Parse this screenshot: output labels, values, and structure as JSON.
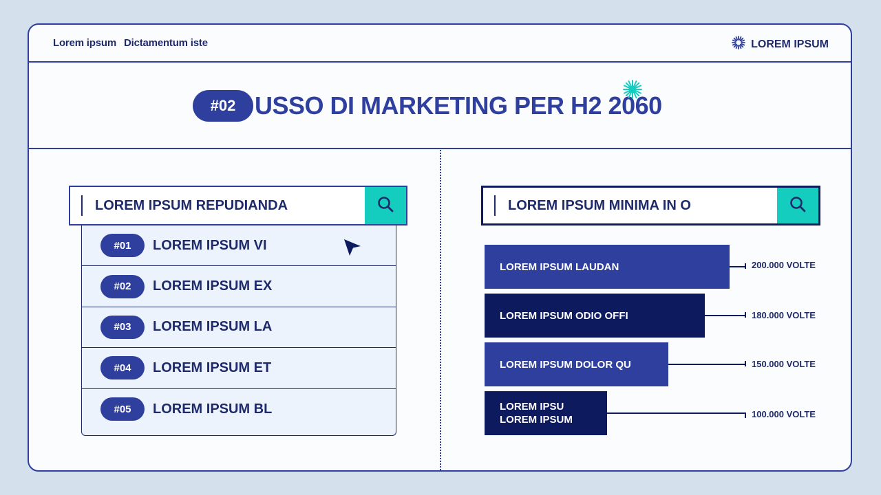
{
  "header": {
    "left_text_a": "Lorem ipsum",
    "left_text_b": "Dictamentum iste",
    "brand": "LOREM IPSUM",
    "brand_icon": "sunburst-icon"
  },
  "title": {
    "pill": "#02",
    "text": "USSO DI MARKETING PER H2 2060",
    "accent_color": "#14cdbf"
  },
  "left_search": {
    "query": "LOREM IPSUM REPUDIANDA",
    "icon": "search-icon",
    "suggestions": [
      {
        "num": "#01",
        "label": "LOREM IPSUM VI"
      },
      {
        "num": "#02",
        "label": "LOREM IPSUM EX"
      },
      {
        "num": "#03",
        "label": "LOREM IPSUM LA"
      },
      {
        "num": "#04",
        "label": "LOREM IPSUM ET"
      },
      {
        "num": "#05",
        "label": "LOREM IPSUM BL"
      }
    ]
  },
  "right_search": {
    "query": "LOREM IPSUM MINIMA IN O",
    "icon": "search-icon"
  },
  "bars": [
    {
      "label": "LOREM IPSUM LAUDAN",
      "value_text": "200.000 VOLTE",
      "value": 200000
    },
    {
      "label": "LOREM IPSUM ODIO OFFI",
      "value_text": "180.000 VOLTE",
      "value": 180000
    },
    {
      "label": "LOREM IPSUM DOLOR QU",
      "value_text": "150.000 VOLTE",
      "value": 150000
    },
    {
      "label": "LOREM IPSU\nLOREM IPSUM",
      "value_text": "100.000 VOLTE",
      "value": 100000
    }
  ],
  "colors": {
    "primary": "#2f3f9e",
    "dark": "#0d1a5e",
    "accent": "#14cdbf",
    "background": "#d4e0ec"
  }
}
